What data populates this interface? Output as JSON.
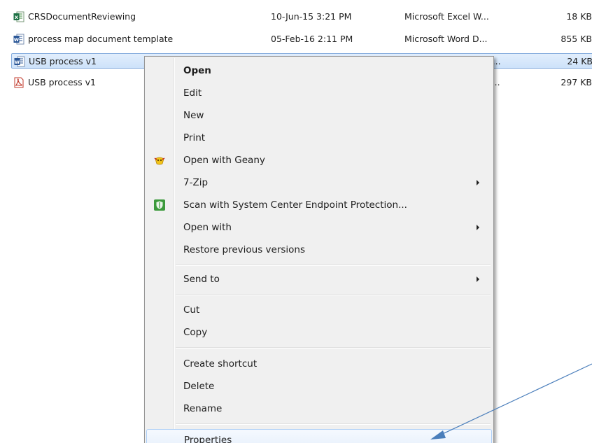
{
  "files": [
    {
      "name": "CRSDocumentReviewing",
      "date": "10-Jun-15 3:21 PM",
      "type": "Microsoft Excel W...",
      "size": "18 KB",
      "icon": "excel-file-icon",
      "selected": false
    },
    {
      "name": "process map document template",
      "date": "05-Feb-16 2:11 PM",
      "type": "Microsoft Word D...",
      "size": "855 KB",
      "icon": "word-file-icon",
      "selected": false
    },
    {
      "name": "USB process v1",
      "date": "",
      "type": "D...",
      "size": "24 KB",
      "icon": "word-file-icon",
      "selected": true
    },
    {
      "name": "USB process v1",
      "date": "",
      "type": "D...",
      "size": "297 KB",
      "icon": "pdf-file-icon",
      "selected": false
    }
  ],
  "context_menu": {
    "items": [
      {
        "label": "Open",
        "bold": true
      },
      {
        "label": "Edit"
      },
      {
        "label": "New"
      },
      {
        "label": "Print"
      },
      {
        "label": "Open with Geany",
        "icon": "geany-icon"
      },
      {
        "label": "7-Zip",
        "submenu": true
      },
      {
        "label": "Scan with System Center Endpoint Protection...",
        "icon": "shield-icon"
      },
      {
        "label": "Open with",
        "submenu": true
      },
      {
        "label": "Restore previous versions"
      },
      {
        "label": "Send to",
        "submenu": true
      },
      {
        "label": "Cut"
      },
      {
        "label": "Copy"
      },
      {
        "label": "Create shortcut"
      },
      {
        "label": "Delete"
      },
      {
        "label": "Rename"
      },
      {
        "label": "Properties",
        "hover": true
      }
    ]
  },
  "colors": {
    "selection": "#cde2fa",
    "menu_background": "#f0f0f0",
    "annotation_arrow": "#4a7ebb"
  }
}
